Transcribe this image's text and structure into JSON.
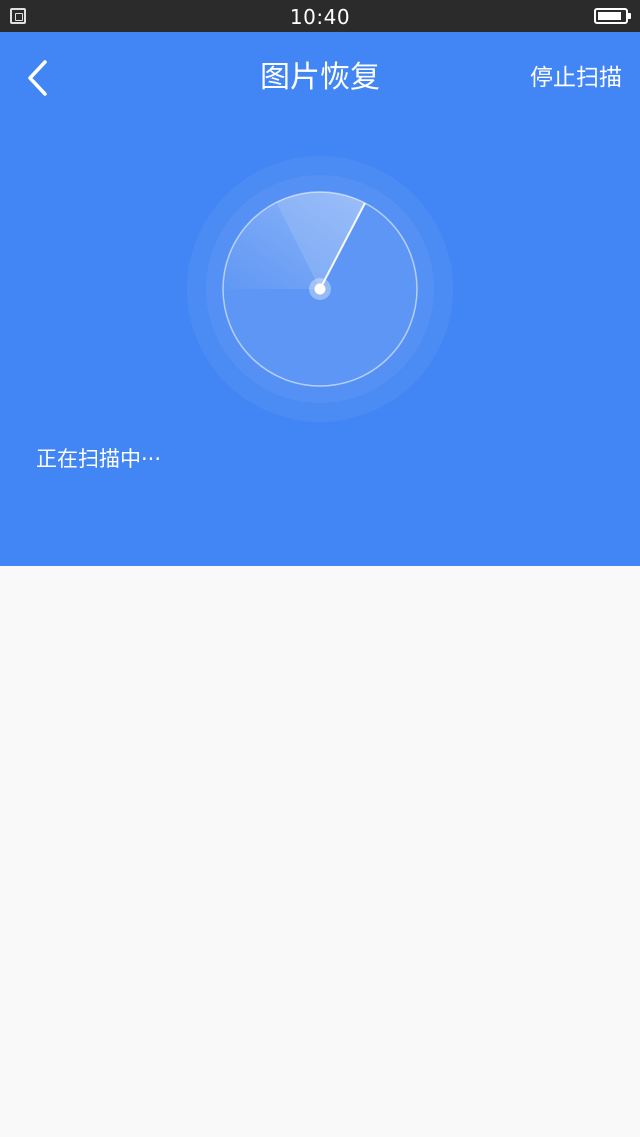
{
  "status_bar": {
    "time": "10:40",
    "left_icon": "notification-icon",
    "battery_icon": "battery-icon",
    "battery_level": 0.9
  },
  "header": {
    "back_icon": "chevron-left-icon",
    "title": "图片恢复",
    "stop_label": "停止扫描",
    "background_color": "#4285f4"
  },
  "scanner": {
    "icon": "radar-scan-icon",
    "status_text": "正在扫描中···"
  },
  "content": {
    "background_color": "#f9f9f9"
  }
}
